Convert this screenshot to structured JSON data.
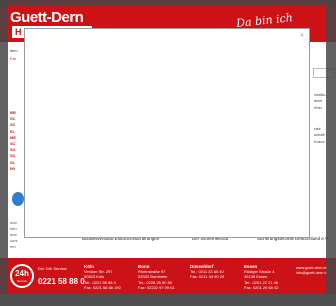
{
  "header": {
    "logo": "Guett-Dern",
    "logo_sub": "H",
    "slogan": "Da bin ich sicher!",
    "icons": [
      "home-icon",
      "user-icon",
      "globe-icon",
      "mail-icon"
    ]
  },
  "left": {
    "top_text": "item",
    "tab_text": "Far",
    "items": [
      "BR",
      "SC",
      "SC",
      "EL",
      "ME",
      "SC",
      "SC",
      "SC",
      "SL",
      "WI"
    ],
    "misc": [
      "oub",
      "tofu",
      "dub",
      "curs",
      "em"
    ]
  },
  "right": {
    "block1": [
      "chafts-",
      "ieser",
      "rther"
    ],
    "block2": [
      "rale",
      "schaft",
      "Krane"
    ]
  },
  "modal": {
    "close_label": "×"
  },
  "bottom_labels": {
    "left": "Bundesverband Einbruchssicherungen",
    "center": "Der Sicherheitsrat",
    "right": "Sicherungstechnik Deutschland e.V."
  },
  "footer": {
    "badge_big": "24h",
    "badge_small": "Service",
    "hotline_label": "Der 24h Service",
    "hotline": "0221 58 88 0",
    "cities": [
      {
        "name": "Köln",
        "lines": [
          "Venloer Str. 297",
          "50823 Köln",
          "Tel.: 0221 58 88 0",
          "Fax: 0221 58 88 190"
        ]
      },
      {
        "name": "Bonn",
        "lines": [
          "Rheinstraße 97",
          "53332 Bornheim",
          "Tel.: 0228 25 50 50",
          "Fax: 02222 97 09 61"
        ]
      },
      {
        "name": "Düsseldorf",
        "lines": [
          "",
          "",
          "Tel.: 0211 33 60 40",
          "Fax: 0211 34 90 20"
        ]
      },
      {
        "name": "Essen",
        "lines": [
          "Rüdiger Straße 4",
          "45139 Essen",
          "Tel.: 0201 22 21 46",
          "Fax: 0201 29 65 42"
        ]
      }
    ],
    "url": "www.guett-dern.de",
    "email": "info@guett-dern.de"
  },
  "colors": {
    "brand_red": "#cc1117",
    "overlay": "#4f4f4f"
  }
}
